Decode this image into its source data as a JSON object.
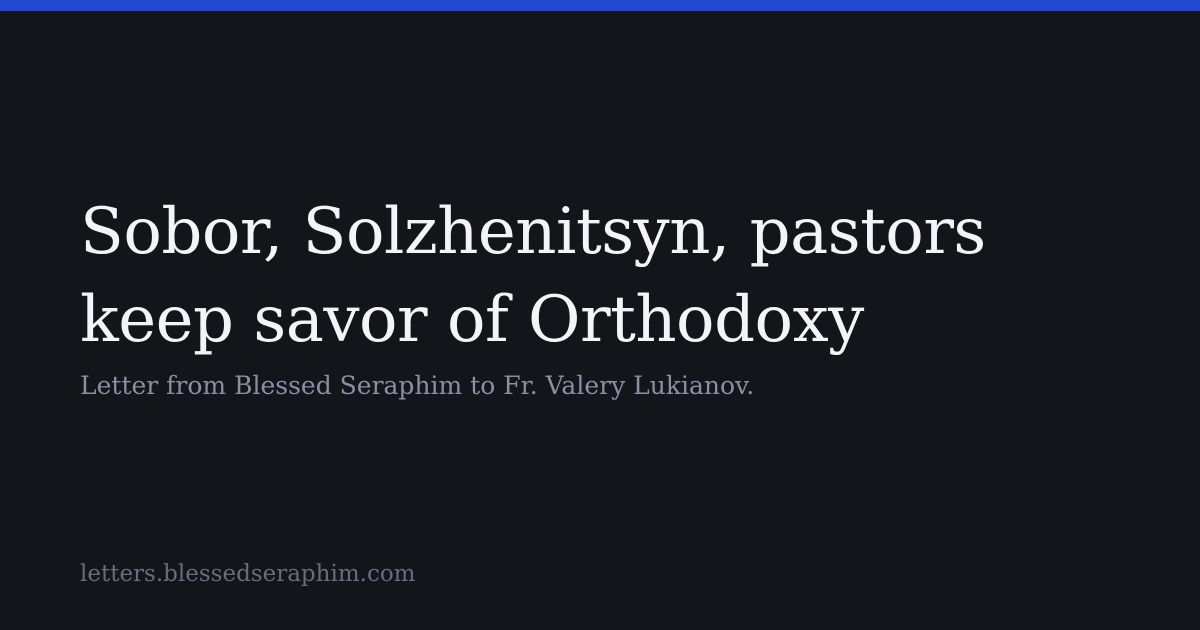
{
  "card": {
    "title": "Sobor, Solzhenitsyn, pastors keep savor of Orthodoxy",
    "subtitle": "Letter from Blessed Seraphim to Fr. Valery Lukianov.",
    "domain": "letters.blessedseraphim.com"
  },
  "colors": {
    "background": "#14151b",
    "accent_bar": "#2348d4",
    "title": "#f4f4f6",
    "subtitle": "#8f8da6",
    "domain": "#6c6c78"
  }
}
